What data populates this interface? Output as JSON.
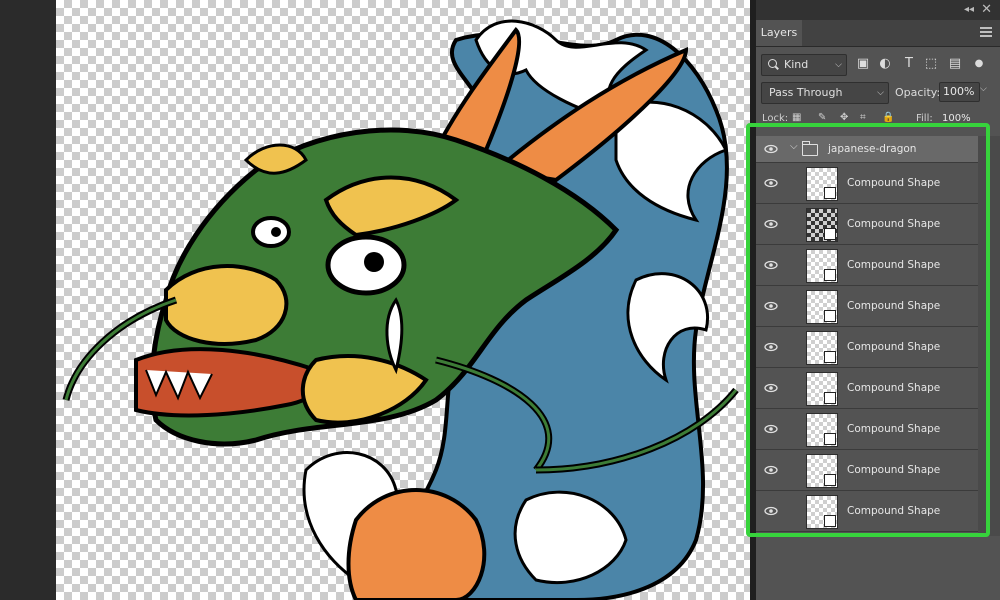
{
  "panel": {
    "tab_label": "Layers",
    "kind_filter": "Kind",
    "blend_mode": "Pass Through",
    "opacity_label": "Opacity:",
    "opacity_value": "100%",
    "lock_label": "Lock:",
    "fill_label": "Fill:",
    "fill_value": "100%"
  },
  "group": {
    "name": "japanese-dragon"
  },
  "layers": [
    {
      "name": "Compound Shape"
    },
    {
      "name": "Compound Shape"
    },
    {
      "name": "Compound Shape"
    },
    {
      "name": "Compound Shape"
    },
    {
      "name": "Compound Shape"
    },
    {
      "name": "Compound Shape"
    },
    {
      "name": "Compound Shape"
    },
    {
      "name": "Compound Shape"
    },
    {
      "name": "Compound Shape"
    }
  ],
  "colors": {
    "highlight": "#37d33c",
    "dragon_green": "#3d7c36",
    "dragon_yellow": "#f0c24f",
    "dragon_orange": "#ee8c45",
    "wave_blue": "#4b85a8"
  }
}
